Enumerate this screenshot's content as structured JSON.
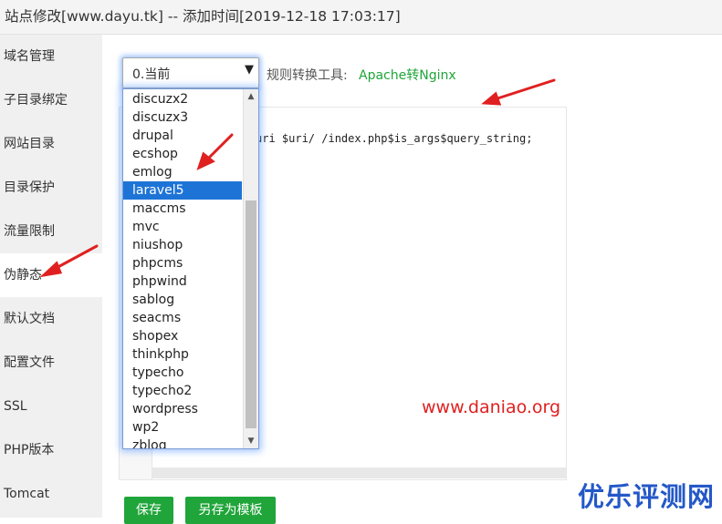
{
  "titlebar": {
    "title": "站点修改[www.dayu.tk] -- 添加时间[2019-12-18 17:03:17]"
  },
  "sidebar": {
    "items": [
      {
        "label": "域名管理"
      },
      {
        "label": "子目录绑定"
      },
      {
        "label": "网站目录"
      },
      {
        "label": "目录保护"
      },
      {
        "label": "流量限制"
      },
      {
        "label": "伪静态",
        "active": true
      },
      {
        "label": "默认文档"
      },
      {
        "label": "配置文件"
      },
      {
        "label": "SSL"
      },
      {
        "label": "PHP版本"
      },
      {
        "label": "Tomcat"
      }
    ]
  },
  "rewrite": {
    "select_value": "0.当前",
    "tool_label": "规则转换工具:",
    "tool_link": "Apache转Nginx",
    "editor_line": "uri $uri/ /index.php$is_args$query_string;",
    "dropdown_options": [
      "discuzx2",
      "discuzx3",
      "drupal",
      "ecshop",
      "emlog",
      "laravel5",
      "maccms",
      "mvc",
      "niushop",
      "phpcms",
      "phpwind",
      "sablog",
      "seacms",
      "shopex",
      "thinkphp",
      "typecho",
      "typecho2",
      "wordpress",
      "wp2",
      "zblog"
    ],
    "selected_option": "laravel5"
  },
  "buttons": {
    "save": "保存",
    "save_template": "另存为模板"
  },
  "watermark": {
    "url": "www.daniao.org",
    "brand": "优乐评测网"
  },
  "icons": {
    "select_arrow": "triangle-down-icon",
    "scroll_up": "triangle-up-icon",
    "scroll_down": "triangle-down-icon"
  },
  "colors": {
    "accent": "#20a53a",
    "selection": "#1e74d6",
    "annotation": "#e02020",
    "brand": "#2458c8"
  }
}
